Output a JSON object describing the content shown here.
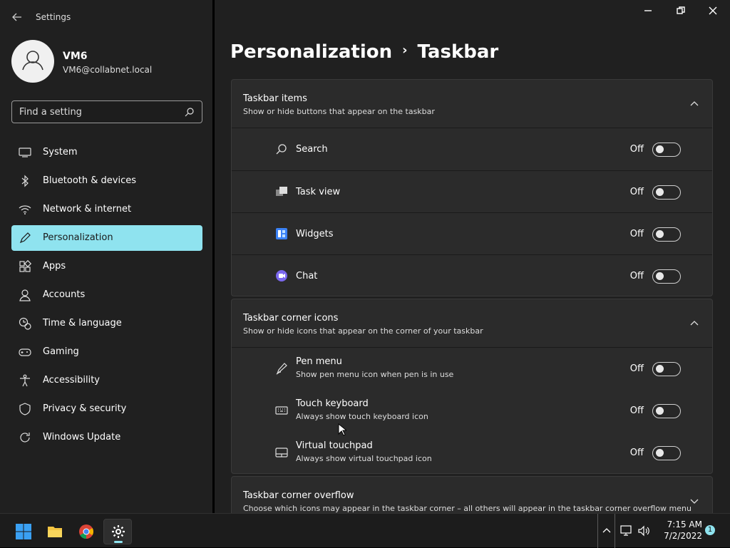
{
  "window": {
    "title": "Settings",
    "minimize": "—",
    "restore": "⧉",
    "close": "✕"
  },
  "user": {
    "name": "VM6",
    "email": "VM6@collabnet.local"
  },
  "search": {
    "placeholder": "Find a setting"
  },
  "nav": [
    {
      "label": "System",
      "icon": "monitor-icon"
    },
    {
      "label": "Bluetooth & devices",
      "icon": "bluetooth-icon"
    },
    {
      "label": "Network & internet",
      "icon": "wifi-icon"
    },
    {
      "label": "Personalization",
      "icon": "pen-icon",
      "active": true
    },
    {
      "label": "Apps",
      "icon": "apps-icon"
    },
    {
      "label": "Accounts",
      "icon": "person-icon"
    },
    {
      "label": "Time & language",
      "icon": "clock-globe-icon"
    },
    {
      "label": "Gaming",
      "icon": "gamepad-icon"
    },
    {
      "label": "Accessibility",
      "icon": "accessibility-icon"
    },
    {
      "label": "Privacy & security",
      "icon": "shield-icon"
    },
    {
      "label": "Windows Update",
      "icon": "update-icon"
    }
  ],
  "breadcrumb": {
    "parent": "Personalization",
    "separator": "›",
    "current": "Taskbar"
  },
  "sections": {
    "items": {
      "title": "Taskbar items",
      "subtitle": "Show or hide buttons that appear on the taskbar",
      "rows": [
        {
          "label": "Search",
          "state": "Off",
          "icon": "search-icon"
        },
        {
          "label": "Task view",
          "state": "Off",
          "icon": "task-view-icon"
        },
        {
          "label": "Widgets",
          "state": "Off",
          "icon": "widgets-icon"
        },
        {
          "label": "Chat",
          "state": "Off",
          "icon": "chat-icon"
        }
      ]
    },
    "corner": {
      "title": "Taskbar corner icons",
      "subtitle": "Show or hide icons that appear on the corner of your taskbar",
      "rows": [
        {
          "label": "Pen menu",
          "sub": "Show pen menu icon when pen is in use",
          "state": "Off",
          "icon": "pen-menu-icon"
        },
        {
          "label": "Touch keyboard",
          "sub": "Always show touch keyboard icon",
          "state": "Off",
          "icon": "keyboard-icon"
        },
        {
          "label": "Virtual touchpad",
          "sub": "Always show virtual touchpad icon",
          "state": "Off",
          "icon": "touchpad-icon"
        }
      ]
    },
    "overflow": {
      "title": "Taskbar corner overflow",
      "subtitle": "Choose which icons may appear in the taskbar corner – all others will appear in the taskbar corner overflow menu"
    }
  },
  "taskbar": {
    "time": "7:15 AM",
    "date": "7/2/2022",
    "notifications": "1"
  },
  "colors": {
    "accent": "#8fe3ef",
    "background": "#202020",
    "card": "#2b2b2b"
  }
}
